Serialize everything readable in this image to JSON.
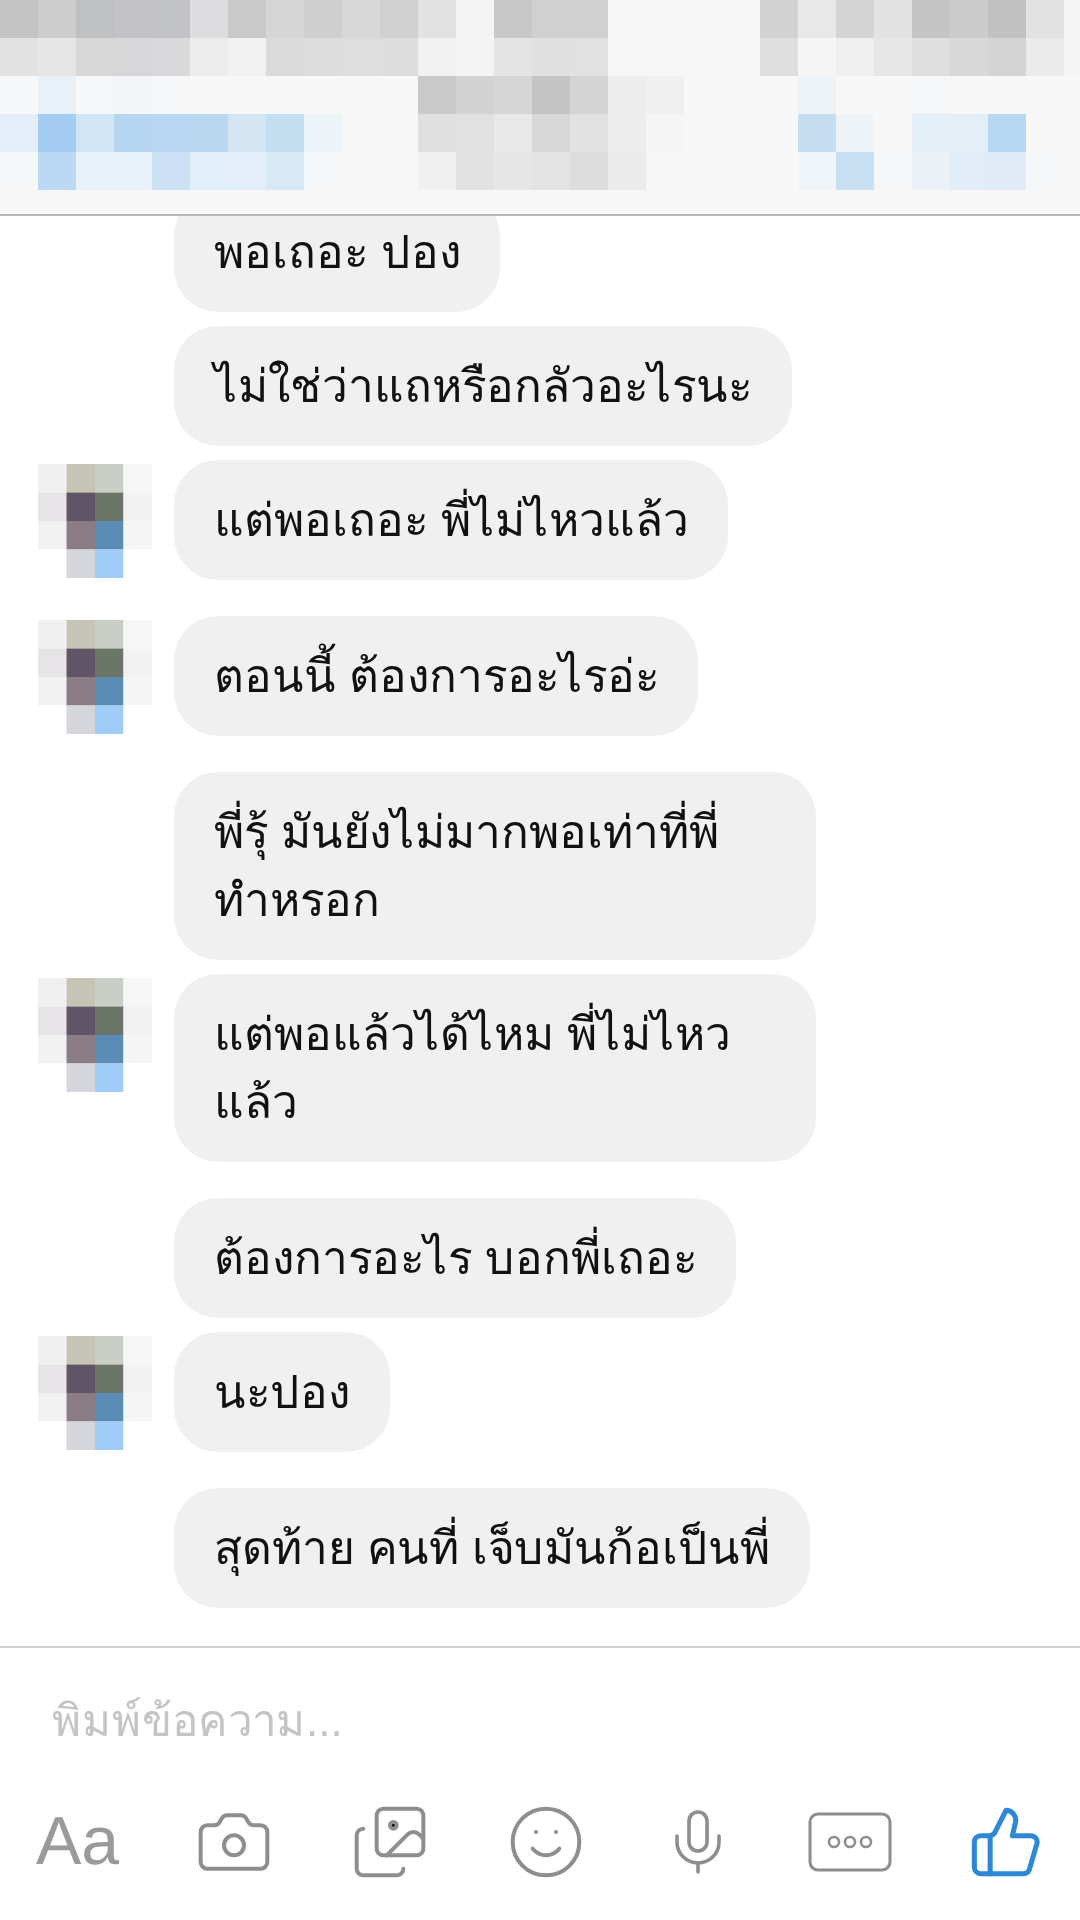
{
  "messages": [
    {
      "text": "พอเถอะ ปอง",
      "avatar": false
    },
    {
      "text": "ไม่ใช่ว่าแถหรือกลัวอะไรนะ",
      "avatar": false
    },
    {
      "text": "แต่พอเถอะ พี่ไม่ไหวแล้ว",
      "avatar": true
    },
    {
      "text": "ตอนนี้ ต้องการอะไรอ่ะ",
      "avatar": true
    },
    {
      "text": "พี่รุ้ มันยังไม่มากพอเท่าที่พี่ ทำหรอก",
      "avatar": false
    },
    {
      "text": "แต่พอแล้วได้ไหม พี่ไม่ไหว แล้ว",
      "avatar": true
    },
    {
      "text": "ต้องการอะไร บอกพี่เถอะ",
      "avatar": false
    },
    {
      "text": "นะปอง",
      "avatar": true
    },
    {
      "text": "สุดท้าย คนที่ เจ็บมันก้อเป็นพี่",
      "avatar": false
    }
  ],
  "composer": {
    "placeholder": "พิมพ์ข้อความ...",
    "text_button": "Aa"
  }
}
